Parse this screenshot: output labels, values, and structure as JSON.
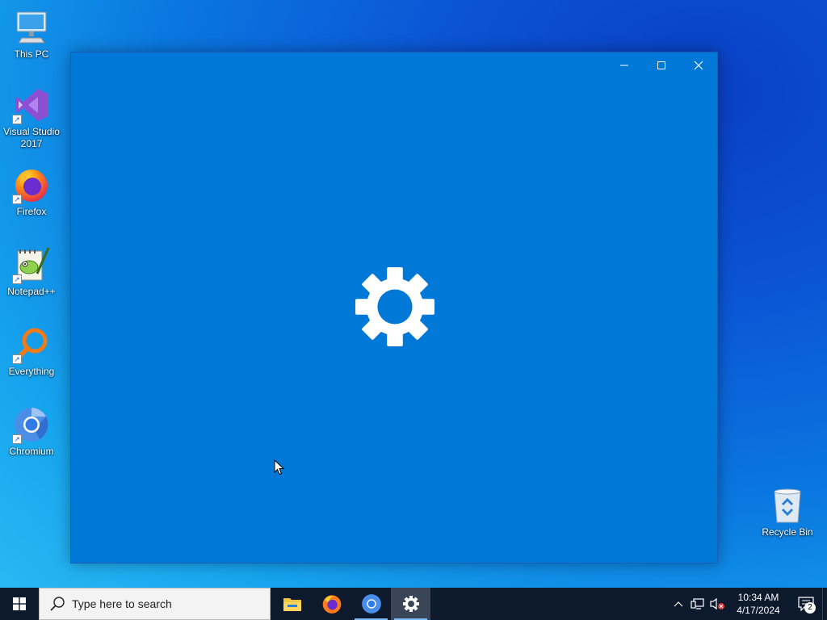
{
  "desktop": {
    "icons": [
      {
        "label": "This PC",
        "icon": "computer-icon"
      },
      {
        "label": "Visual Studio 2017",
        "icon": "visual-studio-icon"
      },
      {
        "label": "Firefox",
        "icon": "firefox-icon"
      },
      {
        "label": "Notepad++",
        "icon": "notepadpp-icon"
      },
      {
        "label": "Everything",
        "icon": "everything-search-icon"
      },
      {
        "label": "Chromium",
        "icon": "chromium-icon"
      },
      {
        "label": "Recycle Bin",
        "icon": "recycle-bin-icon"
      }
    ]
  },
  "window": {
    "app": "Settings",
    "state": "loading-splash",
    "background_color": "#0078d7",
    "controls": {
      "minimize": "minimize-icon",
      "maximize": "maximize-icon",
      "close": "close-icon"
    }
  },
  "taskbar": {
    "search_placeholder": "Type here to search",
    "apps": [
      {
        "name": "File Explorer",
        "icon": "folder-icon",
        "active": false
      },
      {
        "name": "Firefox",
        "icon": "firefox-icon",
        "active": false
      },
      {
        "name": "Chromium",
        "icon": "chromium-icon",
        "active": false
      },
      {
        "name": "Settings",
        "icon": "gear-icon",
        "active": true
      }
    ],
    "clock": {
      "time": "10:34 AM",
      "date": "4/17/2024"
    },
    "notification_count": "2"
  },
  "colors": {
    "taskbar": "#0d1a2e",
    "accent": "#0078d7"
  }
}
